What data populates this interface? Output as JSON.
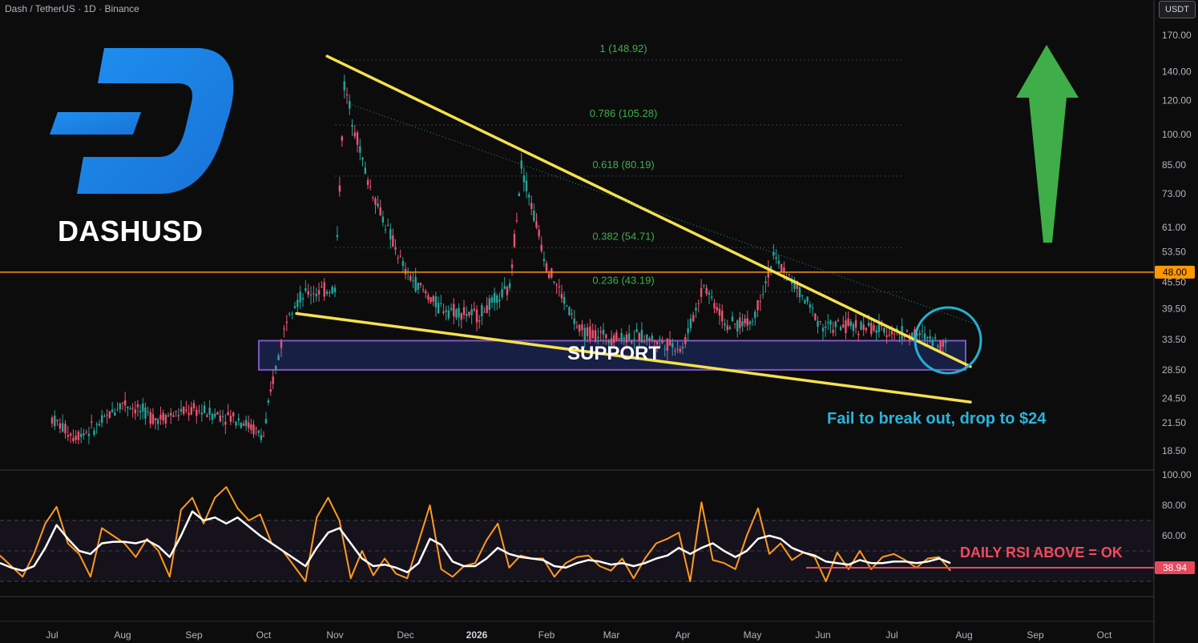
{
  "header": {
    "symbol_title": "Dash / TetherUS · 1D · Binance",
    "currency": "USDT"
  },
  "annotations": {
    "pair_label": "DASHUSD",
    "support_label": "SUPPORT",
    "breakout_note": "Fail to break out, drop to $24",
    "rsi_note": "DAILY RSI ABOVE = OK",
    "logo_letter": "D",
    "arrow": "up-arrow-icon"
  },
  "colors": {
    "background": "#0c0c0d",
    "up_candle": "#26a69a",
    "down_candle": "#ef5370",
    "trendline": "#f5e14b",
    "fib_text": "#3fae49",
    "resistance": "#ff9800",
    "support_zone": "#7e57c2",
    "rsi_line": "#ff9a1f",
    "rsi_ma": "#ffffff",
    "logo": "#1c88e5",
    "highlight_circle": "#22b1d0",
    "arrow": "#3fae49",
    "rsi_note": "#f04a5e"
  },
  "chart_data": [
    {
      "type": "candlestick",
      "title": "Dash / TetherUS · 1D · Binance",
      "scale": "log",
      "y_axis_labels": [
        "170.00",
        "140.00",
        "120.00",
        "100.00",
        "85.00",
        "73.00",
        "61.00",
        "53.50",
        "45.50",
        "39.50",
        "33.50",
        "28.50",
        "24.50",
        "21.50",
        "18.50"
      ],
      "x_axis_labels": [
        "Jul",
        "Aug",
        "Sep",
        "Oct",
        "Nov",
        "Dec",
        "2026",
        "Feb",
        "Mar",
        "Apr",
        "May",
        "Jun",
        "Jul",
        "Aug",
        "Sep",
        "Oct"
      ],
      "price_path_dates": [
        "Jul 1",
        "Jul 10",
        "Jul 20",
        "Aug 1",
        "Aug 15",
        "Sep 1",
        "Sep 20",
        "Oct 1",
        "Oct 5",
        "Oct 12",
        "Oct 20",
        "Nov 1",
        "Nov 5",
        "Nov 15",
        "Dec 1",
        "Dec 15",
        "Jan 1",
        "Jan 15",
        "Jan 20",
        "Feb 1",
        "Feb 15",
        "Mar 1",
        "Mar 15",
        "Apr 1",
        "Apr 10",
        "Apr 20",
        "May 1",
        "May 10",
        "May 20",
        "Jun 1",
        "Jun 15",
        "Jul 1",
        "Jul 15",
        "Jul 25"
      ],
      "price_path": [
        22,
        20,
        21,
        24,
        22,
        23,
        22,
        20,
        27,
        40,
        43,
        44,
        130,
        78,
        48,
        40,
        38,
        44,
        85,
        50,
        35,
        34,
        34,
        32,
        45,
        36,
        37,
        52,
        44,
        36,
        36,
        35,
        34,
        32.5
      ],
      "fib_levels": [
        {
          "label": "1 (148.92)",
          "value": 148.92
        },
        {
          "label": "0.786 (105.28)",
          "value": 105.28
        },
        {
          "label": "0.618 (80.19)",
          "value": 80.19
        },
        {
          "label": "0.382 (54.71)",
          "value": 54.71
        },
        {
          "label": "0.236 (43.19)",
          "value": 43.19
        }
      ],
      "horizontal_line": {
        "label": "48.00",
        "value": 48.0
      },
      "support_zone": {
        "label": "SUPPORT",
        "low": 28.5,
        "high": 33.3,
        "from": "Oct 1",
        "to": "Jul 31"
      },
      "trendlines": [
        {
          "name": "upper",
          "from": {
            "x": "Oct 28",
            "y": 152
          },
          "to": {
            "x": "Jul 31",
            "y": 29
          }
        },
        {
          "name": "lower",
          "from": {
            "x": "Oct 15",
            "y": 38.5
          },
          "to": {
            "x": "Jul 31",
            "y": 24
          }
        }
      ],
      "annotation": "Fail to break out, drop to $24"
    },
    {
      "type": "line",
      "title": "",
      "y_axis_labels": [
        "100.00",
        "80.00",
        "60.00"
      ],
      "ylim": [
        20,
        100
      ],
      "bands": [
        70,
        50,
        30
      ],
      "current_value": "38.94",
      "series": [
        {
          "values": [
            47,
            40,
            33,
            48,
            68,
            79,
            55,
            48,
            33,
            65,
            60,
            55,
            46,
            58,
            50,
            33,
            77,
            85,
            68,
            85,
            92,
            78,
            70,
            74,
            55,
            50,
            40,
            30,
            72,
            85,
            70,
            32,
            50,
            34,
            45,
            35,
            32,
            56,
            80,
            38,
            33,
            40,
            42,
            57,
            68,
            39,
            47,
            45,
            45,
            33,
            42,
            46,
            47,
            40,
            37,
            45,
            32,
            45,
            55,
            58,
            62,
            30,
            82,
            44,
            42,
            38,
            60,
            78,
            48,
            55,
            44,
            49,
            46,
            30,
            49,
            38,
            50,
            38,
            46,
            48,
            44,
            39,
            45,
            46,
            37
          ]
        },
        {
          "values": [
            42,
            39,
            37,
            40,
            52,
            67,
            58,
            50,
            48,
            55,
            56,
            56,
            55,
            57,
            53,
            46,
            60,
            76,
            70,
            72,
            68,
            72,
            66,
            60,
            55,
            50,
            45,
            40,
            52,
            62,
            65,
            55,
            45,
            40,
            41,
            39,
            36,
            42,
            58,
            54,
            43,
            40,
            40,
            45,
            52,
            48,
            46,
            45,
            44,
            40,
            39,
            42,
            44,
            43,
            41,
            42,
            40,
            42,
            45,
            47,
            52,
            48,
            52,
            55,
            50,
            46,
            50,
            58,
            60,
            58,
            52,
            49,
            47,
            43,
            42,
            41,
            44,
            42,
            42,
            43,
            43,
            42,
            43,
            45,
            42
          ]
        }
      ],
      "annotation": "DAILY RSI ABOVE = OK"
    }
  ]
}
